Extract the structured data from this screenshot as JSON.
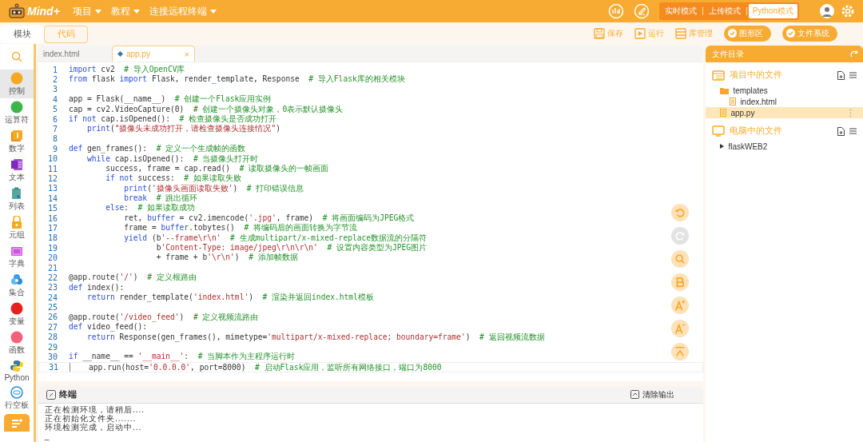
{
  "app": {
    "logo": "Mind+",
    "menus": [
      {
        "label": "项目"
      },
      {
        "label": "教程"
      },
      {
        "label": "连接远程终端"
      }
    ],
    "modes": [
      {
        "label": "实时模式",
        "selected": false
      },
      {
        "label": "上传模式",
        "selected": false
      },
      {
        "label": "Python模式",
        "selected": true
      }
    ]
  },
  "view_tabs": [
    {
      "label": "模块",
      "selected": false
    },
    {
      "label": "代码",
      "selected": true
    }
  ],
  "toolbar": [
    {
      "kind": "save",
      "label": "保存"
    },
    {
      "kind": "run",
      "label": "运行"
    },
    {
      "kind": "library",
      "label": "库管理"
    },
    {
      "kind": "toggle",
      "label": "图形区",
      "on": true
    },
    {
      "kind": "toggle",
      "label": "文件系统",
      "on": true
    }
  ],
  "categories": [
    {
      "kind": "search"
    },
    {
      "kind": "dot",
      "label": "控制",
      "color": "#f7a823",
      "selected": true
    },
    {
      "kind": "dot",
      "label": "运算符",
      "color": "#3cb64a",
      "selected": false
    },
    {
      "kind": "number",
      "label": "数字",
      "selected": false
    },
    {
      "kind": "text",
      "label": "文本",
      "selected": false
    },
    {
      "kind": "list",
      "label": "列表",
      "selected": false
    },
    {
      "kind": "tuple",
      "label": "元组",
      "selected": false
    },
    {
      "kind": "dict",
      "label": "字典",
      "selected": false
    },
    {
      "kind": "set",
      "label": "集合",
      "selected": false
    },
    {
      "kind": "dot",
      "label": "变量",
      "color": "#e8201f",
      "selected": false
    },
    {
      "kind": "dot",
      "label": "函数",
      "color": "#f5617a",
      "selected": false
    },
    {
      "kind": "python",
      "label": "Python",
      "selected": false
    },
    {
      "kind": "board",
      "label": "行空板",
      "selected": false
    },
    {
      "kind": "extension"
    }
  ],
  "editor_tabs": [
    {
      "label": "index.html",
      "selected": false
    },
    {
      "label": "app.py",
      "selected": true,
      "close": "×"
    }
  ],
  "code": [
    {
      "number": "1",
      "current": false,
      "tokens": [
        {
          "kind": "kw",
          "text": "import"
        },
        {
          "kind": "p",
          "text": " cv2  "
        },
        {
          "kind": "c",
          "text": "# 导入OpenCV库"
        }
      ]
    },
    {
      "number": "2",
      "current": false,
      "tokens": [
        {
          "kind": "kw",
          "text": "from"
        },
        {
          "kind": "p",
          "text": " flask "
        },
        {
          "kind": "kw",
          "text": "import"
        },
        {
          "kind": "p",
          "text": " Flask, render_template, Response  "
        },
        {
          "kind": "c",
          "text": "# 导入Flask库的相关模块"
        }
      ]
    },
    {
      "number": "3",
      "current": false
    },
    {
      "number": "4",
      "current": false,
      "tokens": [
        {
          "kind": "p",
          "text": "app = Flask(__name__)  "
        },
        {
          "kind": "c",
          "text": "# 创建一个Flask应用实例"
        }
      ]
    },
    {
      "number": "5",
      "current": false,
      "tokens": [
        {
          "kind": "p",
          "text": "cap = cv2.VideoCapture(0)  "
        },
        {
          "kind": "c",
          "text": "# 创建一个摄像头对象，0表示默认摄像头"
        }
      ]
    },
    {
      "number": "6",
      "current": false,
      "tokens": [
        {
          "kind": "kw",
          "text": "if not"
        },
        {
          "kind": "p",
          "text": " cap.isOpened():  "
        },
        {
          "kind": "c",
          "text": "# 检查摄像头是否成功打开"
        }
      ]
    },
    {
      "number": "7",
      "current": false,
      "tokens": [
        {
          "kind": "kw",
          "text": "    print"
        },
        {
          "kind": "p",
          "text": "("
        },
        {
          "kind": "s",
          "text": "\"摄像头未成功打开，请检查摄像头连接情况\""
        },
        {
          "kind": "p",
          "text": ")"
        }
      ]
    },
    {
      "number": "8",
      "current": false
    },
    {
      "number": "9",
      "current": false,
      "tokens": [
        {
          "kind": "kw",
          "text": "def"
        },
        {
          "kind": "p",
          "text": " gen_frames():  "
        },
        {
          "kind": "c",
          "text": "# 定义一个生成帧的函数"
        }
      ]
    },
    {
      "number": "10",
      "current": false,
      "tokens": [
        {
          "kind": "kw",
          "text": "    while"
        },
        {
          "kind": "p",
          "text": " cap.isOpened():  "
        },
        {
          "kind": "c",
          "text": "# 当摄像头打开时"
        }
      ]
    },
    {
      "number": "11",
      "current": false,
      "tokens": [
        {
          "kind": "p",
          "text": "        success, frame = cap.read()  "
        },
        {
          "kind": "c",
          "text": "# 读取摄像头的一帧画面"
        }
      ]
    },
    {
      "number": "12",
      "current": false,
      "tokens": [
        {
          "kind": "kw",
          "text": "        if not"
        },
        {
          "kind": "p",
          "text": " success:  "
        },
        {
          "kind": "c",
          "text": "# 如果读取失败"
        }
      ]
    },
    {
      "number": "13",
      "current": false,
      "tokens": [
        {
          "kind": "kw",
          "text": "            print"
        },
        {
          "kind": "p",
          "text": "("
        },
        {
          "kind": "s",
          "text": "'摄像头画面读取失败'"
        },
        {
          "kind": "p",
          "text": ")  "
        },
        {
          "kind": "c",
          "text": "# 打印错误信息"
        }
      ]
    },
    {
      "number": "14",
      "current": false,
      "tokens": [
        {
          "kind": "kw",
          "text": "            break"
        },
        {
          "kind": "c",
          "text": "  # 跳出循环"
        }
      ]
    },
    {
      "number": "15",
      "current": false,
      "tokens": [
        {
          "kind": "kw",
          "text": "        else"
        },
        {
          "kind": "p",
          "text": ":  "
        },
        {
          "kind": "c",
          "text": "# 如果读取成功"
        }
      ]
    },
    {
      "number": "16",
      "current": false,
      "tokens": [
        {
          "kind": "p",
          "text": "            ret, "
        },
        {
          "kind": "kw",
          "text": "buffer"
        },
        {
          "kind": "p",
          "text": " = cv2.imencode("
        },
        {
          "kind": "s",
          "text": "'.jpg'"
        },
        {
          "kind": "p",
          "text": ", frame)  "
        },
        {
          "kind": "c",
          "text": "# 将画面编码为JPEG格式"
        }
      ]
    },
    {
      "number": "17",
      "current": false,
      "tokens": [
        {
          "kind": "p",
          "text": "            frame = "
        },
        {
          "kind": "kw",
          "text": "buffer"
        },
        {
          "kind": "p",
          "text": ".tobytes()  "
        },
        {
          "kind": "c",
          "text": "# 将编码后的画面转换为字节流"
        }
      ]
    },
    {
      "number": "18",
      "current": false,
      "tokens": [
        {
          "kind": "kw",
          "text": "            yield"
        },
        {
          "kind": "p",
          "text": " (b"
        },
        {
          "kind": "s",
          "text": "'--frame\\r\\n'"
        },
        {
          "kind": "c",
          "text": "  # 生成multipart/x-mixed-replace数据流的分隔符"
        }
      ]
    },
    {
      "number": "19",
      "current": false,
      "tokens": [
        {
          "kind": "p",
          "text": "                   b"
        },
        {
          "kind": "s",
          "text": "'Content-Type: image/jpeg\\r\\n\\r\\n'"
        },
        {
          "kind": "c",
          "text": "  # 设置内容类型为JPEG图片"
        }
      ]
    },
    {
      "number": "20",
      "current": false,
      "tokens": [
        {
          "kind": "p",
          "text": "                   + frame + b"
        },
        {
          "kind": "s",
          "text": "'\\r\\n'"
        },
        {
          "kind": "p",
          "text": ")  "
        },
        {
          "kind": "c",
          "text": "# 添加帧数据"
        }
      ]
    },
    {
      "number": "21",
      "current": false
    },
    {
      "number": "22",
      "current": false,
      "tokens": [
        {
          "kind": "p",
          "text": "@app.route("
        },
        {
          "kind": "s",
          "text": "'/'"
        },
        {
          "kind": "p",
          "text": ")  "
        },
        {
          "kind": "c",
          "text": "# 定义根路由"
        }
      ]
    },
    {
      "number": "23",
      "current": false,
      "tokens": [
        {
          "kind": "kw",
          "text": "def"
        },
        {
          "kind": "p",
          "text": " index():"
        }
      ]
    },
    {
      "number": "24",
      "current": false,
      "tokens": [
        {
          "kind": "kw",
          "text": "    return"
        },
        {
          "kind": "p",
          "text": " render_template("
        },
        {
          "kind": "s",
          "text": "'index.html'"
        },
        {
          "kind": "p",
          "text": ")  "
        },
        {
          "kind": "c",
          "text": "# 渲染并返回index.html模板"
        }
      ]
    },
    {
      "number": "25",
      "current": false
    },
    {
      "number": "26",
      "current": false,
      "tokens": [
        {
          "kind": "p",
          "text": "@app.route("
        },
        {
          "kind": "s",
          "text": "'/video_feed'"
        },
        {
          "kind": "p",
          "text": ")  "
        },
        {
          "kind": "c",
          "text": "# 定义视频流路由"
        }
      ]
    },
    {
      "number": "27",
      "current": false,
      "tokens": [
        {
          "kind": "kw",
          "text": "def"
        },
        {
          "kind": "p",
          "text": " video_feed():"
        }
      ]
    },
    {
      "number": "28",
      "current": false,
      "tokens": [
        {
          "kind": "kw",
          "text": "    return"
        },
        {
          "kind": "p",
          "text": " Response(gen_frames(), mimetype="
        },
        {
          "kind": "s",
          "text": "'multipart/x-mixed-replace; boundary=frame'"
        },
        {
          "kind": "p",
          "text": ")  "
        },
        {
          "kind": "c",
          "text": "# 返回视频流数据"
        }
      ]
    },
    {
      "number": "29",
      "current": false
    },
    {
      "number": "30",
      "current": false,
      "tokens": [
        {
          "kind": "kw",
          "text": "if"
        },
        {
          "kind": "p",
          "text": " __name__ == "
        },
        {
          "kind": "s",
          "text": "'__main__'"
        },
        {
          "kind": "p",
          "text": ":  "
        },
        {
          "kind": "c",
          "text": "# 当脚本作为主程序运行时"
        }
      ]
    },
    {
      "number": "31",
      "current": true,
      "tokens": [
        {
          "kind": "p",
          "text": "    app.run(host="
        },
        {
          "kind": "s",
          "text": "'0.0.0.0'"
        },
        {
          "kind": "p",
          "text": ", port=8000)  "
        },
        {
          "kind": "c",
          "text": "# 启动Flask应用，监听所有网络接口，端口为8000"
        }
      ]
    }
  ],
  "float_buttons": [
    {
      "kind": "undo",
      "disabled": false
    },
    {
      "kind": "redo",
      "disabled": true
    },
    {
      "kind": "search",
      "disabled": false
    },
    {
      "kind": "bold",
      "disabled": false
    },
    {
      "kind": "bigger",
      "disabled": false
    },
    {
      "kind": "smaller",
      "disabled": false
    },
    {
      "kind": "top",
      "disabled": false
    }
  ],
  "files": {
    "title": "文件目录",
    "sections": [
      {
        "kind": "project",
        "title": "项目中的文件",
        "items": [
          {
            "kind": "folder",
            "name": "templates",
            "selected": false,
            "children": [
              {
                "kind": "file",
                "name": "index.html",
                "selected": false
              }
            ]
          },
          {
            "kind": "file",
            "name": "app.py",
            "selected": true
          }
        ]
      },
      {
        "kind": "computer",
        "title": "电脑中的文件",
        "items": [
          {
            "kind": "folder",
            "name": "flaskWEB2",
            "expanded": false,
            "selected": false
          }
        ]
      }
    ]
  },
  "terminal": {
    "title": "终端",
    "clear_button": "清除输出",
    "lines": [
      "正在检测环境，请稍后....",
      "正在初始化文件夹.......",
      "环境检测完成，启动中...",
      "_"
    ]
  }
}
